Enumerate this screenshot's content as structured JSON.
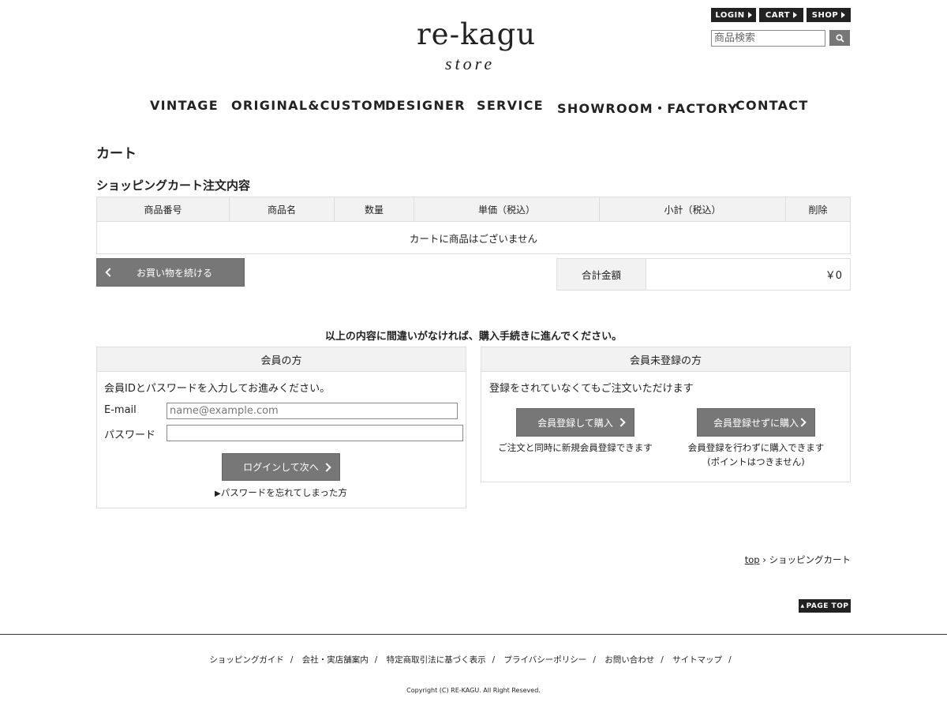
{
  "header": {
    "top_buttons": [
      "LOGIN",
      "CART",
      "SHOP"
    ],
    "search_placeholder": "商品検索",
    "logo_main": "re-kagu",
    "logo_sub": "store"
  },
  "nav": [
    "VINTAGE",
    "ORIGINAL&CUSTOM",
    "DESIGNER",
    "SERVICE",
    "SHOWROOM・FACTORY",
    "CONTACT"
  ],
  "page": {
    "title": "カート",
    "subtitle": "ショッピングカート注文内容"
  },
  "cart_table": {
    "headers": [
      "商品番号",
      "商品名",
      "数量",
      "単価（税込）",
      "小計（税込）",
      "削除"
    ],
    "empty_message": "カートに商品はございません"
  },
  "continue_button": "お買い物を続ける",
  "total": {
    "label": "合計金額",
    "value": "￥0"
  },
  "notice": "以上の内容に間違いがなければ、購入手続きに進んでください。",
  "member": {
    "title": "会員の方",
    "description": "会員IDとパスワードを入力してお進みください。",
    "email_label": "E-mail",
    "email_placeholder": "name@example.com",
    "password_label": "パスワード",
    "login_button": "ログインして次へ",
    "forgot_link": "パスワードを忘れてしまった方"
  },
  "guest": {
    "title": "会員未登録の方",
    "description": "登録をされていなくてもご注文いただけます",
    "register_button": "会員登録して購入",
    "register_note": "ご注文と同時に新規会員登録できます",
    "guest_button": "会員登録せずに購入",
    "guest_note_1": "会員登録を行わずに購入できます",
    "guest_note_2": "(ポイントはつきません)"
  },
  "breadcrumb": {
    "home": "top",
    "current": "ショッピングカート"
  },
  "page_top": "PAGE TOP",
  "footer": {
    "links": [
      "ショッピングガイド",
      "会社・実店舗案内",
      "特定商取引法に基づく表示",
      "プライバシーポリシー",
      "お問い合わせ",
      "サイトマップ"
    ],
    "copyright": "Copyright (C) RE-KAGU. All Right Reseved."
  },
  "colors": {
    "dark": "#222222",
    "button_gray": "#777777",
    "header_bg": "#f2f2f2",
    "border": "#dddddd"
  }
}
